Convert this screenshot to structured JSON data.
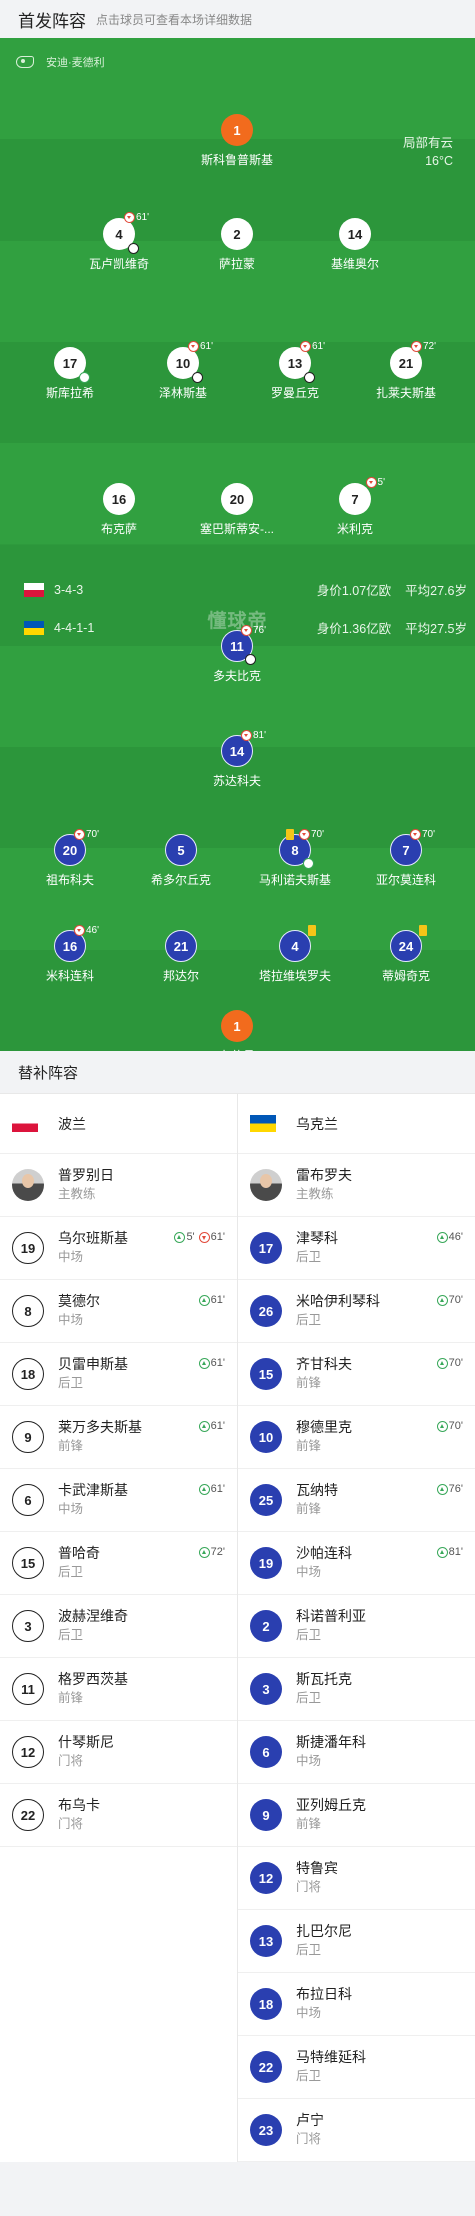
{
  "header": {
    "title": "首发阵容",
    "hint": "点击球员可查看本场详细数据"
  },
  "pitch": {
    "referee": "安迪·麦德利",
    "weather": "局部有云",
    "temperature": "16°C",
    "watermark": "懂球帝"
  },
  "home": {
    "name": "波兰",
    "formation": "3-4-3",
    "value": "身价1.07亿欧",
    "avg_age": "平均27.6岁",
    "players": [
      {
        "number": "1",
        "name": "斯科鲁普斯基",
        "gk": true
      },
      {
        "number": "4",
        "name": "瓦卢凯维奇",
        "sub_out": "61'",
        "goal": true
      },
      {
        "number": "2",
        "name": "萨拉蒙"
      },
      {
        "number": "14",
        "name": "基维奥尔"
      },
      {
        "number": "17",
        "name": "斯库拉希",
        "assist": true
      },
      {
        "number": "10",
        "name": "泽林斯基",
        "sub_out": "61'",
        "goal": true
      },
      {
        "number": "13",
        "name": "罗曼丘克",
        "sub_out": "61'",
        "goal": true
      },
      {
        "number": "21",
        "name": "扎莱夫斯基",
        "sub_out": "72'"
      },
      {
        "number": "16",
        "name": "布克萨"
      },
      {
        "number": "20",
        "name": "塞巴斯蒂安-..."
      },
      {
        "number": "7",
        "name": "米利克",
        "sub_out": "5'"
      }
    ]
  },
  "away": {
    "name": "乌克兰",
    "formation": "4-4-1-1",
    "value": "身价1.36亿欧",
    "avg_age": "平均27.5岁",
    "players": [
      {
        "number": "11",
        "name": "多夫比克",
        "sub_out": "76'",
        "goal": true
      },
      {
        "number": "14",
        "name": "苏达科夫",
        "sub_out": "81'"
      },
      {
        "number": "20",
        "name": "祖布科夫",
        "sub_out": "70'"
      },
      {
        "number": "5",
        "name": "希多尔丘克"
      },
      {
        "number": "8",
        "name": "马利诺夫斯基",
        "sub_out": "70'",
        "yellow": true,
        "assist": true
      },
      {
        "number": "7",
        "name": "亚尔莫连科",
        "sub_out": "70'"
      },
      {
        "number": "16",
        "name": "米科连科",
        "sub_out": "46'"
      },
      {
        "number": "21",
        "name": "邦达尔"
      },
      {
        "number": "4",
        "name": "塔拉维埃罗夫",
        "yellow": true
      },
      {
        "number": "24",
        "name": "蒂姆奇克",
        "yellow": true
      },
      {
        "number": "1",
        "name": "布什昌",
        "gk": true
      }
    ]
  },
  "subs": {
    "title": "替补阵容",
    "home": {
      "coach": {
        "name": "普罗别日",
        "role": "主教练"
      },
      "players": [
        {
          "number": "19",
          "name": "乌尔班斯基",
          "pos": "中场",
          "in": "5'",
          "out": "61'"
        },
        {
          "number": "8",
          "name": "莫德尔",
          "pos": "中场",
          "in": "61'"
        },
        {
          "number": "18",
          "name": "贝雷申斯基",
          "pos": "后卫",
          "in": "61'"
        },
        {
          "number": "9",
          "name": "莱万多夫斯基",
          "pos": "前锋",
          "in": "61'"
        },
        {
          "number": "6",
          "name": "卡武津斯基",
          "pos": "中场",
          "in": "61'"
        },
        {
          "number": "15",
          "name": "普哈奇",
          "pos": "后卫",
          "in": "72'"
        },
        {
          "number": "3",
          "name": "波赫涅维奇",
          "pos": "后卫"
        },
        {
          "number": "11",
          "name": "格罗西茨基",
          "pos": "前锋"
        },
        {
          "number": "12",
          "name": "什琴斯尼",
          "pos": "门将"
        },
        {
          "number": "22",
          "name": "布乌卡",
          "pos": "门将"
        }
      ]
    },
    "away": {
      "coach": {
        "name": "雷布罗夫",
        "role": "主教练"
      },
      "players": [
        {
          "number": "17",
          "name": "津琴科",
          "pos": "后卫",
          "in": "46'"
        },
        {
          "number": "26",
          "name": "米哈伊利琴科",
          "pos": "后卫",
          "in": "70'"
        },
        {
          "number": "15",
          "name": "齐甘科夫",
          "pos": "前锋",
          "in": "70'"
        },
        {
          "number": "10",
          "name": "穆德里克",
          "pos": "前锋",
          "in": "70'"
        },
        {
          "number": "25",
          "name": "瓦纳特",
          "pos": "前锋",
          "in": "76'"
        },
        {
          "number": "19",
          "name": "沙帕连科",
          "pos": "中场",
          "in": "81'"
        },
        {
          "number": "2",
          "name": "科诺普利亚",
          "pos": "后卫"
        },
        {
          "number": "3",
          "name": "斯瓦托克",
          "pos": "后卫"
        },
        {
          "number": "6",
          "name": "斯捷潘年科",
          "pos": "中场"
        },
        {
          "number": "9",
          "name": "亚列姆丘克",
          "pos": "前锋"
        },
        {
          "number": "12",
          "name": "特鲁宾",
          "pos": "门将"
        },
        {
          "number": "13",
          "name": "扎巴尔尼",
          "pos": "后卫"
        },
        {
          "number": "18",
          "name": "布拉日科",
          "pos": "中场"
        },
        {
          "number": "22",
          "name": "马特维延科",
          "pos": "后卫"
        },
        {
          "number": "23",
          "name": "卢宁",
          "pos": "门将"
        }
      ]
    }
  }
}
